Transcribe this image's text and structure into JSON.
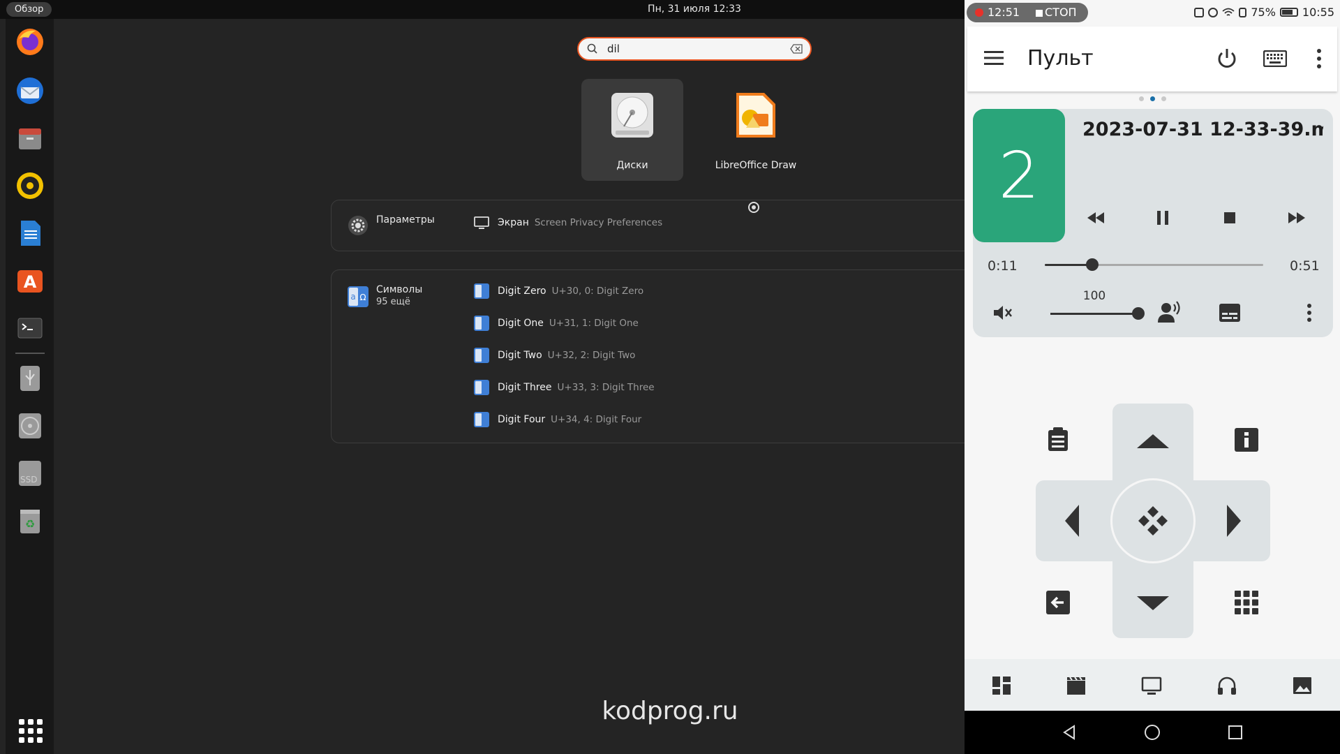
{
  "ubuntu": {
    "topbar": {
      "overview_label": "Обзор",
      "clock": "Пн, 31 июля  12:33"
    },
    "dock": {
      "items": [
        "firefox-icon",
        "thunderbird-icon",
        "files-icon",
        "rhythmbox-icon",
        "writer-icon",
        "app-center-icon",
        "terminal-icon",
        "usb-drive-icon",
        "disc-icon",
        "ssd-drive-icon",
        "trash-icon"
      ],
      "ssd_label": "SSD"
    },
    "search": {
      "value": "dil"
    },
    "apps": [
      {
        "label": "Диски",
        "icon": "disks-icon",
        "selected": true
      },
      {
        "label": "LibreOffice Draw",
        "icon": "libreoffice-draw-icon",
        "selected": false
      }
    ],
    "settings_provider": {
      "name": "Параметры",
      "result": {
        "title": "Экран",
        "desc": "Screen Privacy Preferences"
      }
    },
    "symbols_provider": {
      "name": "Символы",
      "more": "95 ещё",
      "results": [
        {
          "title": "Digit Zero",
          "desc": "U+30, 0: Digit Zero"
        },
        {
          "title": "Digit One",
          "desc": "U+31, 1: Digit One"
        },
        {
          "title": "Digit Two",
          "desc": "U+32, 2: Digit Two"
        },
        {
          "title": "Digit Three",
          "desc": "U+33, 3: Digit Three"
        },
        {
          "title": "Digit Four",
          "desc": "U+34, 4: Digit Four"
        }
      ]
    },
    "watermark": "kodprog.ru",
    "accent_color": "#e95420"
  },
  "android": {
    "statusbar": {
      "rec_time": "12:51",
      "rec_stop": "СТОП",
      "battery": "75%",
      "time": "10:55",
      "battery_level": 0.75
    },
    "appbar": {
      "title": "Пульт"
    },
    "page_indicator": {
      "count": 3,
      "active": 1
    },
    "player": {
      "thumb_number": "2",
      "title": "2023-07-31 12-33-39.m..",
      "elapsed": "0:11",
      "total": "0:51",
      "progress": 0.216,
      "volume_label": "100",
      "volume": 1.0,
      "thumb_color": "#2aa57a"
    },
    "bottom_tabs": [
      "dashboard-icon",
      "movies-icon",
      "tv-icon",
      "music-icon",
      "pictures-icon"
    ]
  }
}
